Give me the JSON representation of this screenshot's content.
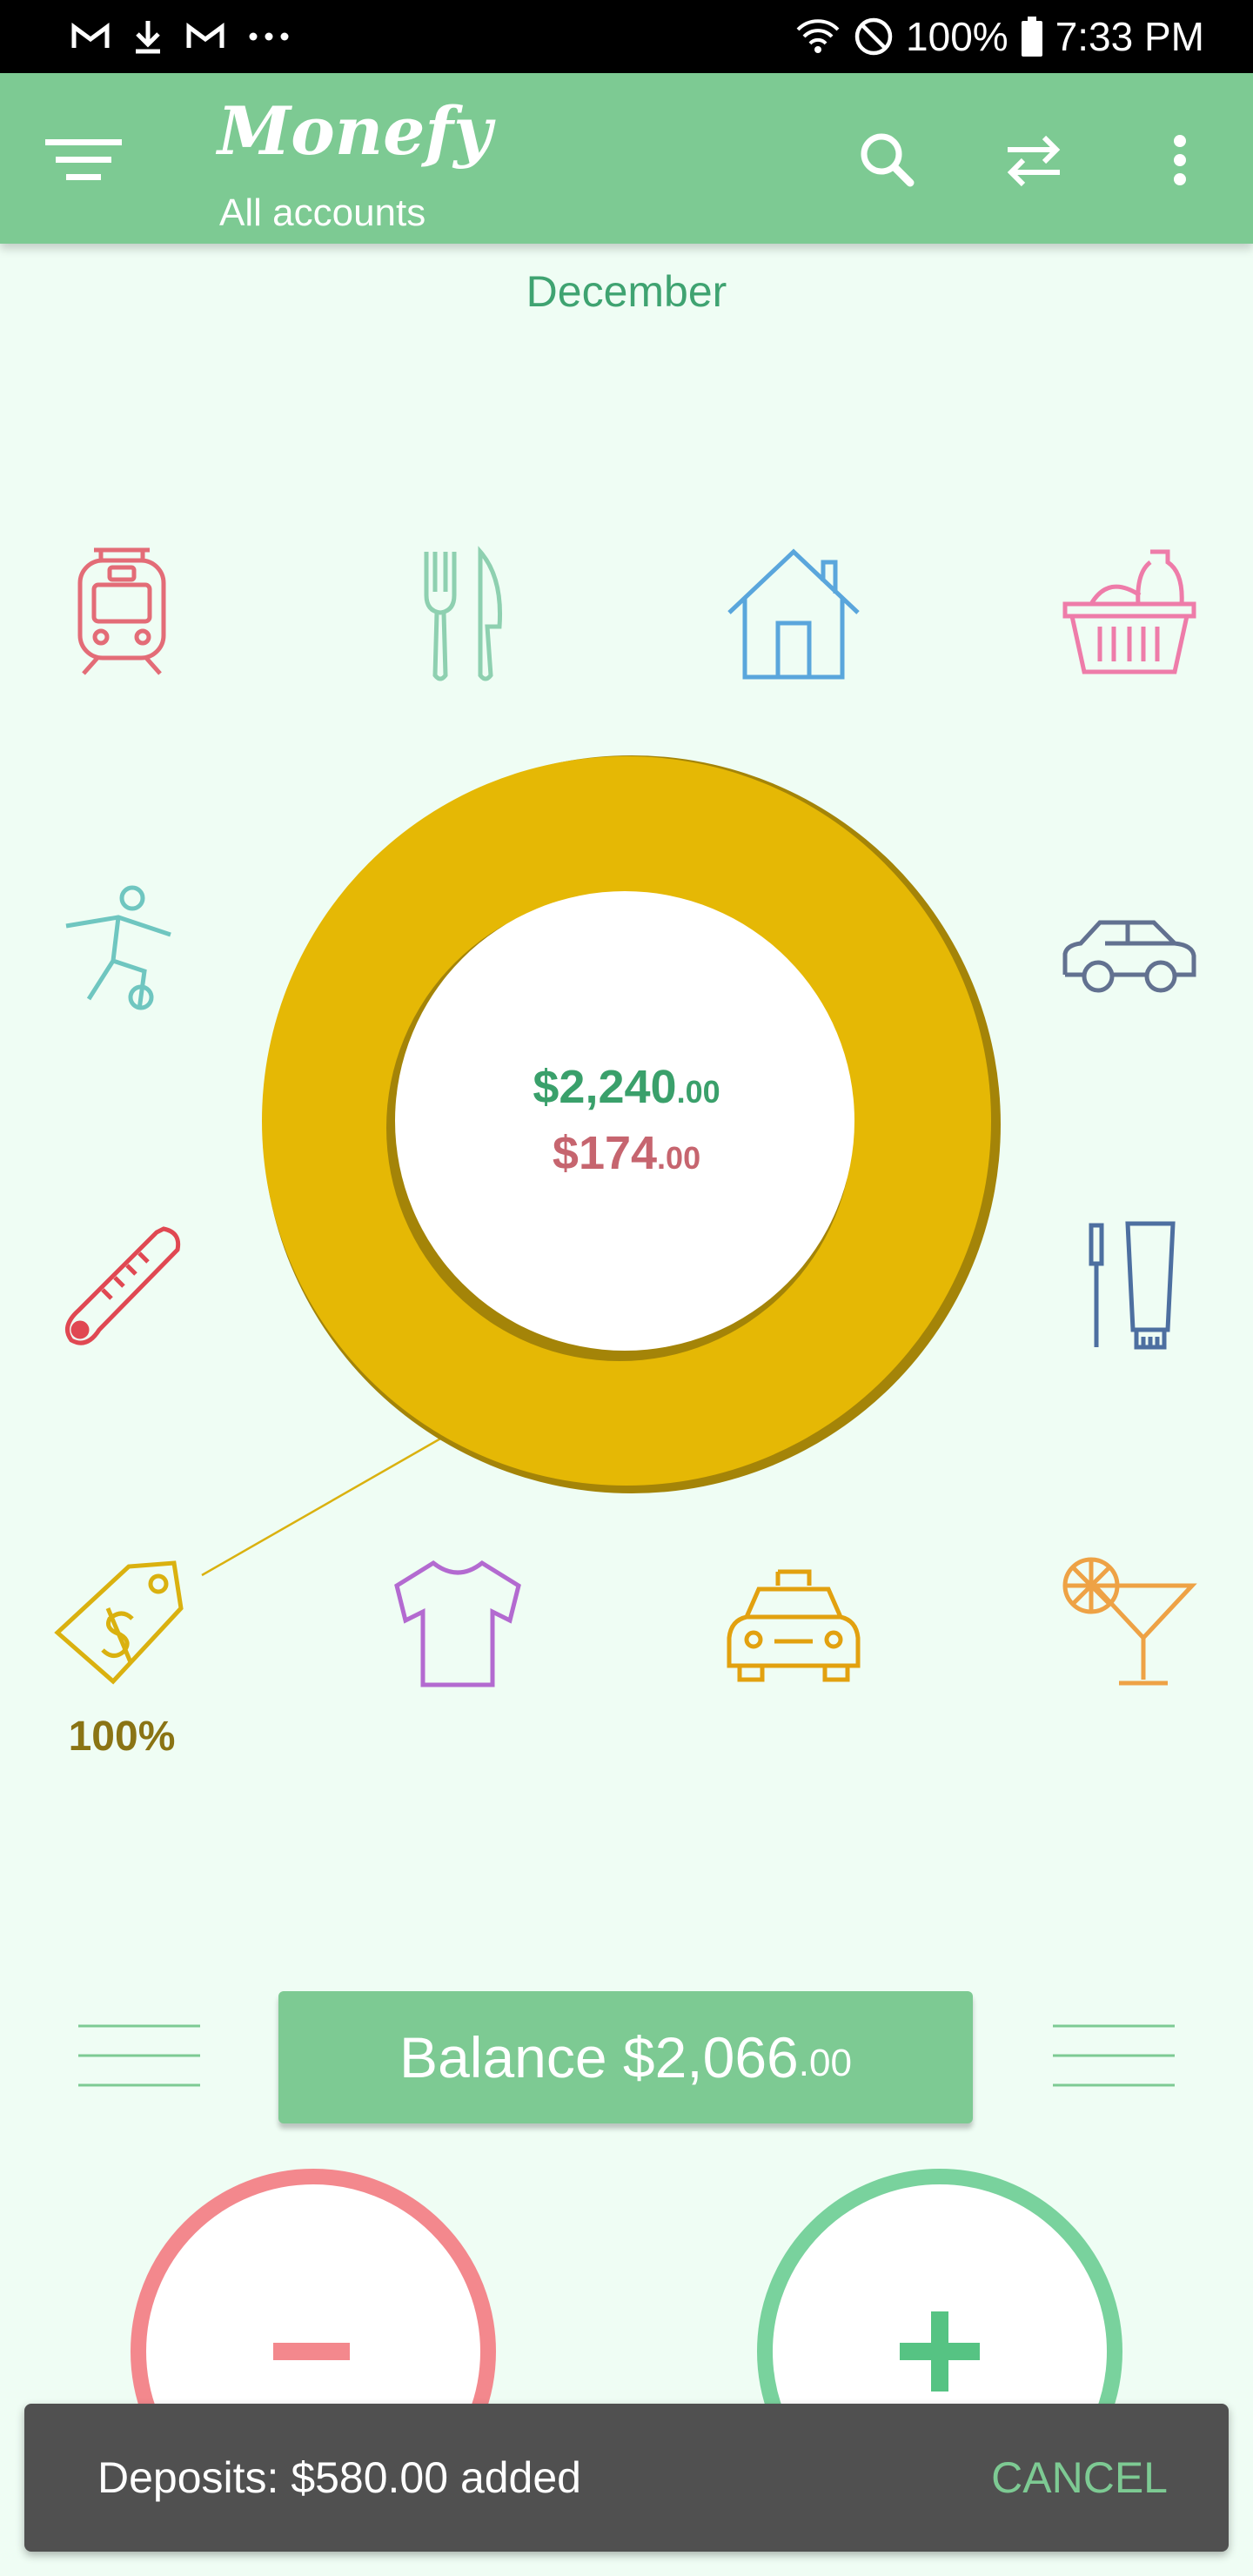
{
  "status_bar": {
    "left_icons": [
      "gmail-icon",
      "download-icon",
      "gmail-icon",
      "more-dots-icon"
    ],
    "battery": "100%",
    "time": "7:33 PM"
  },
  "app_bar": {
    "title": "Monefy",
    "subtitle": "All accounts",
    "icons": [
      "filter-menu-icon",
      "search-icon",
      "transfer-icon",
      "overflow-menu-icon"
    ]
  },
  "period": "December",
  "categories": [
    {
      "name": "transport",
      "icon": "train-icon",
      "color": "#e36c77"
    },
    {
      "name": "eating-out",
      "icon": "fork-knife-icon",
      "color": "#8ed0b0"
    },
    {
      "name": "house",
      "icon": "house-icon",
      "color": "#5aa6dc"
    },
    {
      "name": "food",
      "icon": "grocery-basket-icon",
      "color": "#ee7ca9"
    },
    {
      "name": "sports",
      "icon": "soccer-player-icon",
      "color": "#6fc6c0"
    },
    {
      "name": "car",
      "icon": "car-icon",
      "color": "#627190"
    },
    {
      "name": "health",
      "icon": "thermometer-icon",
      "color": "#e04852"
    },
    {
      "name": "toiletry",
      "icon": "toothbrush-toothpaste-icon",
      "color": "#4d6fa0"
    },
    {
      "name": "bills",
      "icon": "price-tag-icon",
      "color": "#dab10f"
    },
    {
      "name": "clothes",
      "icon": "tshirt-icon",
      "color": "#b36ad0"
    },
    {
      "name": "taxi",
      "icon": "taxi-icon",
      "color": "#e2a10f"
    },
    {
      "name": "entertainment",
      "icon": "cocktail-icon",
      "color": "#eea245"
    }
  ],
  "highlight_category_percent": "100%",
  "chart": {
    "donut_color": "#e5b805",
    "donut_shadow": "#a48408",
    "income_main": "$2,240",
    "income_cents": ".00",
    "expense_main": "$174",
    "expense_cents": ".00"
  },
  "balance": {
    "label_main": "Balance $2,066",
    "label_cents": ".00"
  },
  "buttons": {
    "expense_color": "#f3888d",
    "income_color": "#79d29d"
  },
  "snackbar": {
    "message": "Deposits: $580.00 added",
    "action": "CANCEL"
  }
}
